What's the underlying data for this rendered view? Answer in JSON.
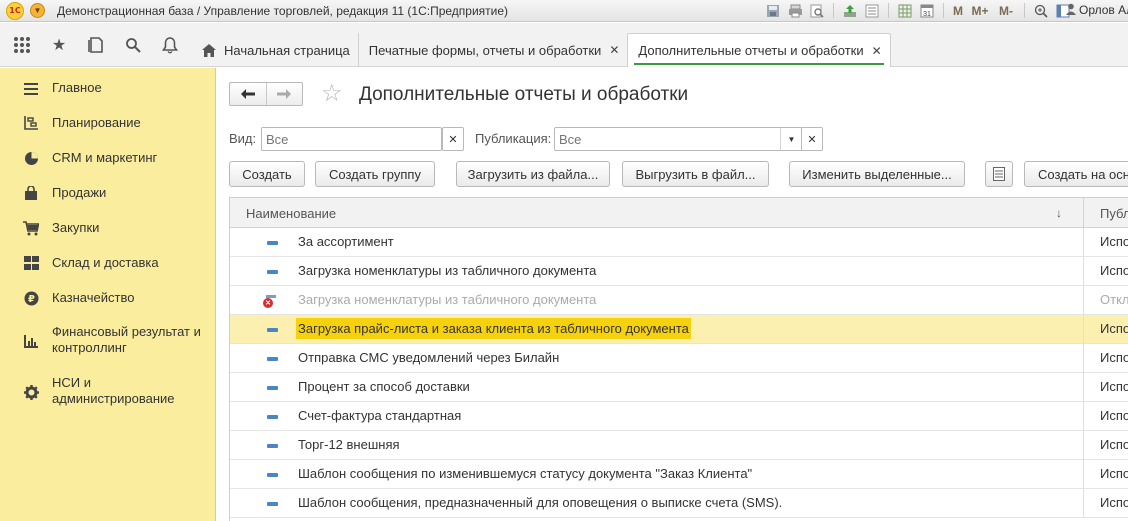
{
  "titlebar": {
    "logo": "1С",
    "title": "Демонстрационная база / Управление торговлей, редакция 11  (1С:Предприятие)",
    "icons": [
      "save-icon",
      "print-icon",
      "preview-icon",
      "upload-icon",
      "list-icon",
      "table-icon",
      "calendar-icon",
      "M",
      "M+",
      "M-",
      "zoom-icon",
      "panel-icon"
    ],
    "calendar_day": "31",
    "m_labels": [
      "M",
      "M+",
      "M-"
    ],
    "user": "Орлов Ал"
  },
  "nav": {
    "tabs": [
      {
        "label": "Начальная страница",
        "closable": false
      },
      {
        "label": "Печатные формы, отчеты и обработки",
        "closable": true
      },
      {
        "label": "Дополнительные отчеты и обработки",
        "closable": true,
        "active": true
      }
    ]
  },
  "sidebar": {
    "items": [
      {
        "label": "Главное",
        "icon": "menu-icon"
      },
      {
        "label": "Планирование",
        "icon": "planning-icon"
      },
      {
        "label": "CRM и маркетинг",
        "icon": "crm-icon"
      },
      {
        "label": "Продажи",
        "icon": "sales-icon"
      },
      {
        "label": "Закупки",
        "icon": "cart-icon"
      },
      {
        "label": "Склад и доставка",
        "icon": "warehouse-icon"
      },
      {
        "label": "Казначейство",
        "icon": "ruble-icon"
      },
      {
        "label": "Финансовый результат и контроллинг",
        "icon": "chart-icon"
      },
      {
        "label": "НСИ и администрирование",
        "icon": "settings-icon"
      }
    ]
  },
  "main": {
    "title": "Дополнительные отчеты и обработки",
    "filters": {
      "vid_label": "Вид:",
      "vid_placeholder": "Все",
      "pub_label": "Публикация:",
      "pub_placeholder": "Все"
    },
    "buttons": {
      "create": "Создать",
      "create_group": "Создать группу",
      "load_from_file": "Загрузить из файла...",
      "save_to_file": "Выгрузить в файл...",
      "change_selected": "Изменить выделенные...",
      "create_based_on": "Создать на осн"
    },
    "table": {
      "col_name": "Наименование",
      "col_pub": "Публ",
      "sort_arrow": "↓",
      "rows": [
        {
          "name": "За ассортимент",
          "pub": "Испо",
          "disabled": false,
          "selected": false
        },
        {
          "name": "Загрузка номенклатуры из табличного документа",
          "pub": "Испо",
          "disabled": false,
          "selected": false
        },
        {
          "name": "Загрузка номенклатуры из табличного документа",
          "pub": "Откл",
          "disabled": true,
          "selected": false
        },
        {
          "name": "Загрузка прайс-листа и заказа клиента из табличного документа",
          "pub": "Испо",
          "disabled": false,
          "selected": true
        },
        {
          "name": "Отправка СМС уведомлений через Билайн",
          "pub": "Испо",
          "disabled": false,
          "selected": false
        },
        {
          "name": "Процент за способ доставки",
          "pub": "Испо",
          "disabled": false,
          "selected": false
        },
        {
          "name": "Счет-фактура стандартная",
          "pub": "Испо",
          "disabled": false,
          "selected": false
        },
        {
          "name": "Торг-12 внешняя",
          "pub": "Испо",
          "disabled": false,
          "selected": false
        },
        {
          "name": "Шаблон сообщения по изменившемуся статусу документа \"Заказ Клиента\"",
          "pub": "Испо",
          "disabled": false,
          "selected": false
        },
        {
          "name": "Шаблон сообщения, предназначенный для оповещения о выписке счета (SMS).",
          "pub": "Испо",
          "disabled": false,
          "selected": false
        }
      ]
    }
  }
}
